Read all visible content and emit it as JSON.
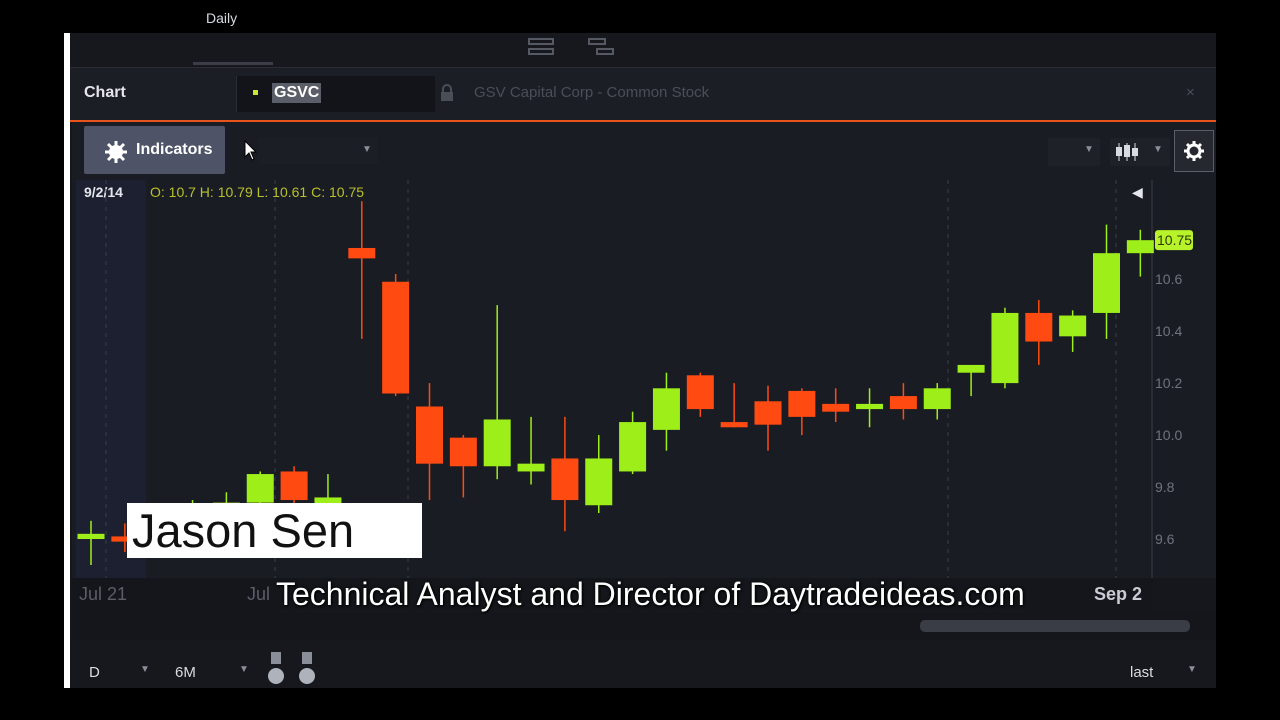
{
  "tabs": {
    "active_label": "Daily"
  },
  "title_bar": {
    "chart_label": "Chart",
    "symbol": "GSVC",
    "description": "GSV Capital Corp - Common Stock",
    "close_symbol": "×"
  },
  "toolbar": {
    "indicators_label": "Indicators"
  },
  "info": {
    "date": "9/2/14",
    "ohlc": "O: 10.7  H: 10.79  L: 10.61  C: 10.75",
    "collapse_symbol": "◀"
  },
  "bottom_bar": {
    "aggregation": "D",
    "timeframe": "6M",
    "price_type": "last",
    "dropdown_arrow": "▼"
  },
  "overlay": {
    "name": "Jason Sen",
    "caption": "Technical Analyst and Director of Daytradeideas.com"
  },
  "colors": {
    "up": "#9eee1a",
    "down": "#ff4a12",
    "accent": "#e8541c",
    "last_price_bg": "#b8f22a"
  },
  "chart_data": {
    "type": "candlestick",
    "symbol": "GSVC",
    "ylim": [
      9.45,
      10.92
    ],
    "yticks": [
      9.6,
      9.8,
      10.0,
      10.2,
      10.4,
      10.6
    ],
    "y_tick_labels": [
      "9.6",
      "9.8",
      "10.0",
      "10.2",
      "10.4",
      "10.6"
    ],
    "x_tick_labels": [
      "Jul 21",
      "Jul",
      "Sep 2"
    ],
    "last_price": 10.75,
    "last_price_label": "10.75",
    "candles": [
      {
        "o": 9.6,
        "h": 9.67,
        "l": 9.5,
        "c": 9.62
      },
      {
        "o": 9.61,
        "h": 9.66,
        "l": 9.55,
        "c": 9.59
      },
      {
        "o": 9.64,
        "h": 9.73,
        "l": 9.6,
        "c": 9.7
      },
      {
        "o": 9.68,
        "h": 9.75,
        "l": 9.63,
        "c": 9.71
      },
      {
        "o": 9.71,
        "h": 9.78,
        "l": 9.66,
        "c": 9.74
      },
      {
        "o": 9.74,
        "h": 9.86,
        "l": 9.7,
        "c": 9.85
      },
      {
        "o": 9.86,
        "h": 9.88,
        "l": 9.72,
        "c": 9.75
      },
      {
        "o": 9.73,
        "h": 9.85,
        "l": 9.69,
        "c": 9.76
      },
      {
        "o": 10.72,
        "h": 10.9,
        "l": 10.37,
        "c": 10.68
      },
      {
        "o": 10.59,
        "h": 10.62,
        "l": 10.15,
        "c": 10.16
      },
      {
        "o": 10.11,
        "h": 10.2,
        "l": 9.75,
        "c": 9.89
      },
      {
        "o": 9.99,
        "h": 10.0,
        "l": 9.76,
        "c": 9.88
      },
      {
        "o": 9.88,
        "h": 10.5,
        "l": 9.83,
        "c": 10.06
      },
      {
        "o": 9.86,
        "h": 10.07,
        "l": 9.81,
        "c": 9.89
      },
      {
        "o": 9.91,
        "h": 10.07,
        "l": 9.63,
        "c": 9.75
      },
      {
        "o": 9.73,
        "h": 10.0,
        "l": 9.7,
        "c": 9.91
      },
      {
        "o": 9.86,
        "h": 10.09,
        "l": 9.85,
        "c": 10.05
      },
      {
        "o": 10.02,
        "h": 10.24,
        "l": 9.94,
        "c": 10.18
      },
      {
        "o": 10.23,
        "h": 10.24,
        "l": 10.07,
        "c": 10.1
      },
      {
        "o": 10.05,
        "h": 10.2,
        "l": 10.03,
        "c": 10.03
      },
      {
        "o": 10.13,
        "h": 10.19,
        "l": 9.94,
        "c": 10.04
      },
      {
        "o": 10.17,
        "h": 10.18,
        "l": 10.0,
        "c": 10.07
      },
      {
        "o": 10.12,
        "h": 10.18,
        "l": 10.05,
        "c": 10.09
      },
      {
        "o": 10.1,
        "h": 10.18,
        "l": 10.03,
        "c": 10.12
      },
      {
        "o": 10.15,
        "h": 10.2,
        "l": 10.06,
        "c": 10.1
      },
      {
        "o": 10.1,
        "h": 10.2,
        "l": 10.06,
        "c": 10.18
      },
      {
        "o": 10.24,
        "h": 10.26,
        "l": 10.15,
        "c": 10.27
      },
      {
        "o": 10.2,
        "h": 10.49,
        "l": 10.18,
        "c": 10.47
      },
      {
        "o": 10.47,
        "h": 10.52,
        "l": 10.27,
        "c": 10.36
      },
      {
        "o": 10.38,
        "h": 10.48,
        "l": 10.32,
        "c": 10.46
      },
      {
        "o": 10.47,
        "h": 10.81,
        "l": 10.37,
        "c": 10.7
      },
      {
        "o": 10.7,
        "h": 10.79,
        "l": 10.61,
        "c": 10.75
      }
    ]
  }
}
